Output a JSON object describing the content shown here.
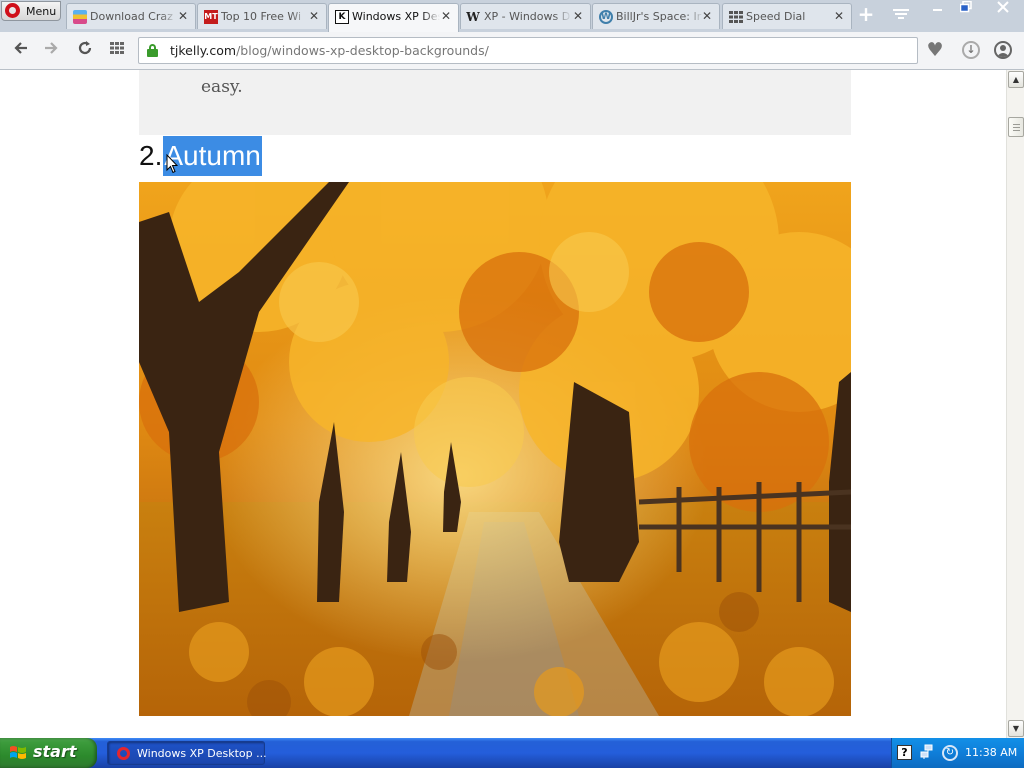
{
  "browser": {
    "menu_label": "Menu",
    "tabs": [
      {
        "title": "Download Craz",
        "favicon": "tab-favicon-download"
      },
      {
        "title": "Top 10 Free Wi",
        "favicon_text": "MT"
      },
      {
        "title": "Windows XP Des",
        "favicon_text": "K"
      },
      {
        "title": "XP - Windows D",
        "favicon_text": "W"
      },
      {
        "title": "BillJr's Space: Ir",
        "favicon": "wordpress-icon"
      },
      {
        "title": "Speed Dial",
        "favicon": "speed-dial-icon"
      }
    ],
    "active_tab_index": 2,
    "url_domain": "tjkelly.com",
    "url_path": "/blog/windows-xp-desktop-backgrounds/"
  },
  "page": {
    "previous_text_tail": "easy.",
    "section_number": "2.",
    "section_title": "Autumn",
    "image_alt": "Autumn road lined with orange trees"
  },
  "taskbar": {
    "start_label": "start",
    "task_label": "Windows XP Desktop ...",
    "help_icon_text": "?",
    "clock": "11:38 AM"
  },
  "colors": {
    "selection": "#3c8ce4",
    "xp_taskbar": "#245edb",
    "start_green": "#3c9b3c",
    "lock_green": "#3a9b2c"
  }
}
